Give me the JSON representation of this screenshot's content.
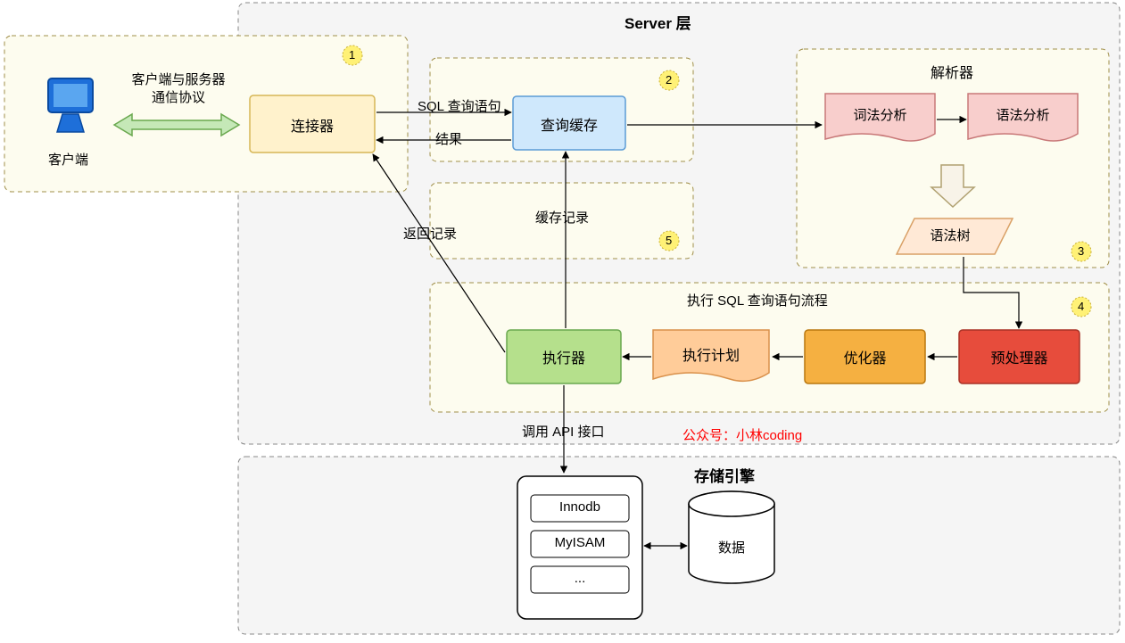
{
  "titles": {
    "server_layer": "Server 层",
    "storage_engine": "存储引擎",
    "parser": "解析器",
    "execute_flow": "执行 SQL 查询语句流程"
  },
  "nodes": {
    "client": "客户端",
    "client_proto1": "客户端与服务器",
    "client_proto2": "通信协议",
    "connector": "连接器",
    "query_cache": "查询缓存",
    "lexical": "词法分析",
    "syntax": "语法分析",
    "syntax_tree": "语法树",
    "preprocessor": "预处理器",
    "optimizer": "优化器",
    "exec_plan": "执行计划",
    "executor": "执行器",
    "innodb": "Innodb",
    "myisam": "MyISAM",
    "ellipsis": "...",
    "data_cyl": "数据"
  },
  "edges": {
    "sql_query": "SQL 查询语句",
    "result": "结果",
    "cache_record": "缓存记录",
    "return_record": "返回记录",
    "api_call": "调用 API 接口"
  },
  "badges": {
    "b1": "1",
    "b2": "2",
    "b3": "3",
    "b4": "4",
    "b5": "5"
  },
  "credit": "公众号：小林coding"
}
